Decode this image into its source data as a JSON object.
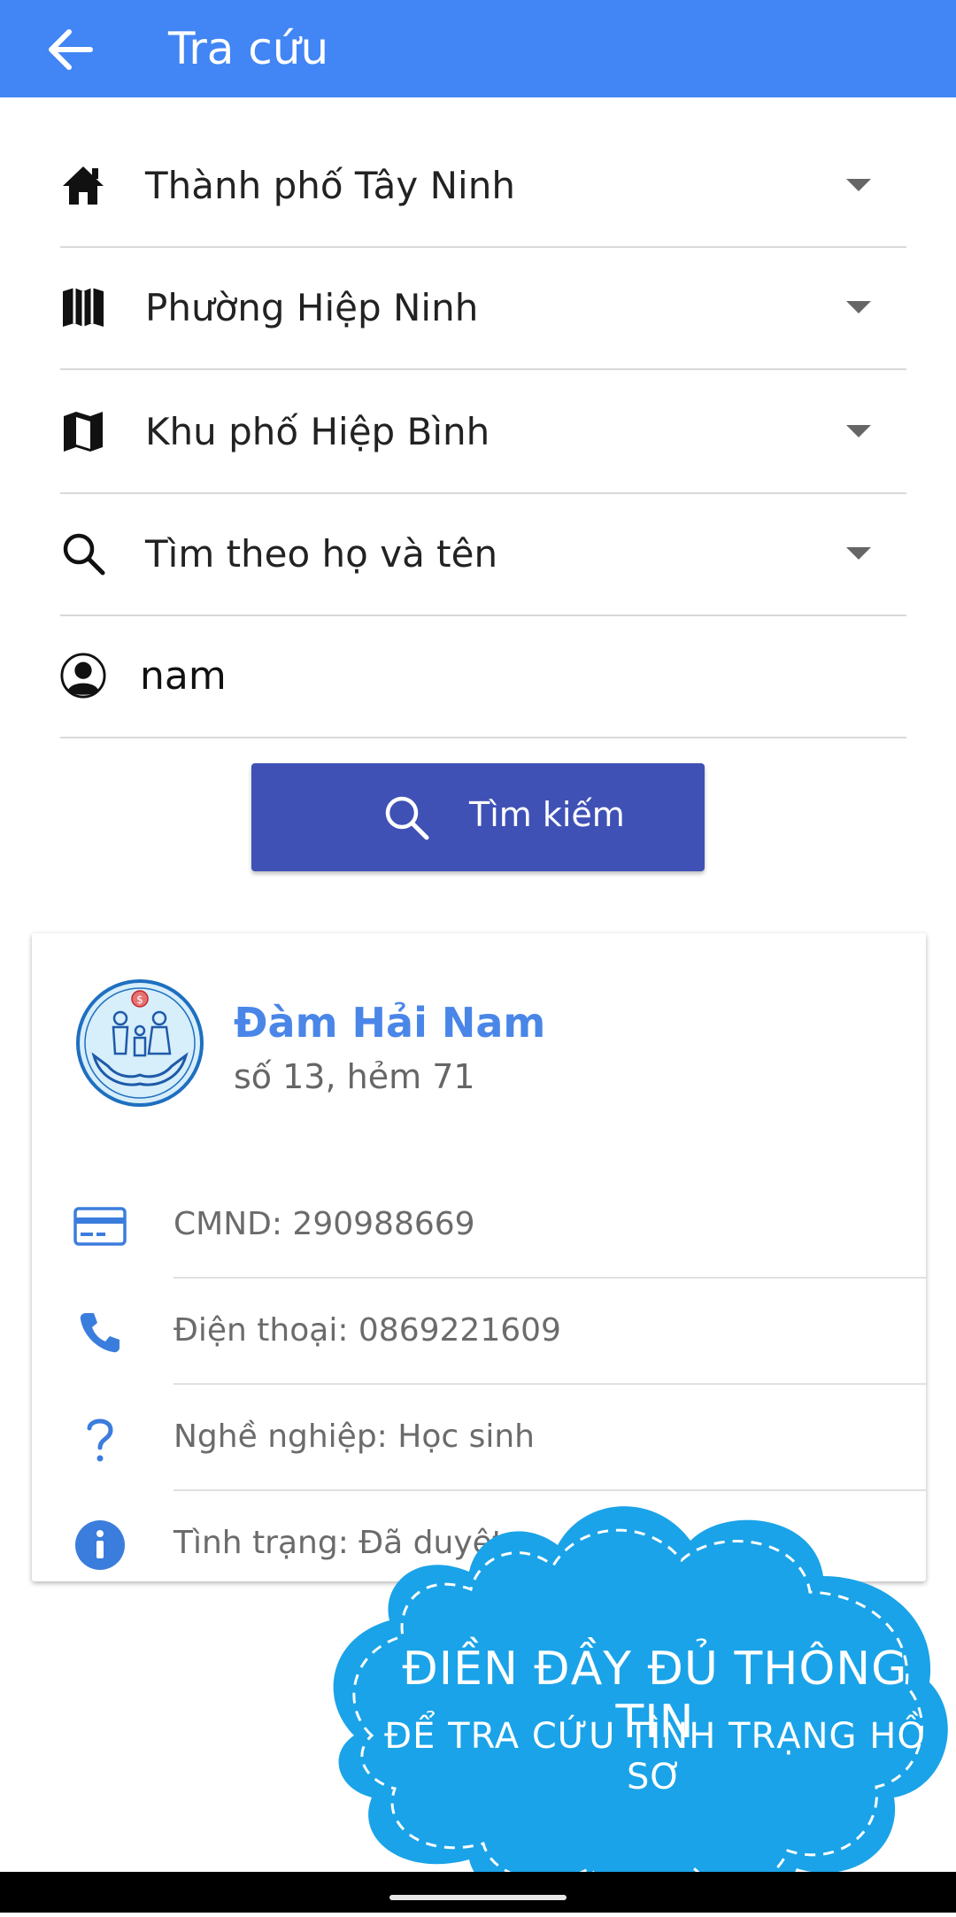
{
  "appbar": {
    "title": "Tra cứu",
    "back_icon": "arrow-back-icon"
  },
  "filters": [
    {
      "label": "Thành phố Tây Ninh",
      "icon": "home-icon"
    },
    {
      "label": "Phường Hiệp Ninh",
      "icon": "map-folded-icon"
    },
    {
      "label": "Khu phố Hiệp Bình",
      "icon": "map-icon"
    },
    {
      "label": "Tìm theo họ và tên",
      "icon": "search-icon"
    }
  ],
  "name_input": {
    "value": "nam",
    "icon": "user-circle-icon"
  },
  "search_button": {
    "label": "Tìm kiếm",
    "icon": "search-icon"
  },
  "result": {
    "name": "Đàm Hải Nam",
    "address": "số 13, hẻm 71",
    "details": [
      {
        "text": "CMND: 290988669",
        "icon": "id-card-icon"
      },
      {
        "text": "Điện thoại: 0869221609",
        "icon": "phone-icon"
      },
      {
        "text": "Nghề nghiệp: Học sinh",
        "icon": "question-icon"
      },
      {
        "text": "Tình trạng: Đã duyệt",
        "icon": "info-icon"
      }
    ]
  },
  "promo": {
    "line1": "ĐIỀN ĐẦY ĐỦ THÔNG TIN",
    "line2": "ĐỂ TRA CỨU TÌNH TRẠNG HỒ SƠ"
  },
  "colors": {
    "primary": "#4285f4",
    "button": "#3f51b5",
    "accent_text": "#4a86e8",
    "cloud": "#1aa3e8"
  }
}
